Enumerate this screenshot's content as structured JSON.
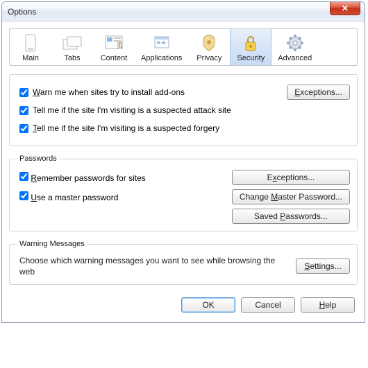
{
  "window": {
    "title": "Options",
    "close_glyph": "✕"
  },
  "toolbar": {
    "items": [
      {
        "label": "Main"
      },
      {
        "label": "Tabs"
      },
      {
        "label": "Content"
      },
      {
        "label": "Applications"
      },
      {
        "label": "Privacy"
      },
      {
        "label": "Security"
      },
      {
        "label": "Advanced"
      }
    ],
    "selected_index": 5
  },
  "group_top": {
    "warn_addons_prefix": "W",
    "warn_addons_rest": "arn me when sites try to install add-ons",
    "warn_addons_checked": true,
    "attack_site": "Tell me if the site I'm visiting is a suspected attack site",
    "attack_site_checked": true,
    "forgery_prefix": "T",
    "forgery_rest": "ell me if the site I'm visiting is a suspected forgery",
    "forgery_checked": true,
    "exceptions_u": "E",
    "exceptions_rest": "xceptions..."
  },
  "passwords": {
    "legend": "Passwords",
    "remember_prefix": "R",
    "remember_rest": "emember passwords for sites",
    "remember_checked": true,
    "master_prefix": "U",
    "master_rest": "se a master password",
    "master_checked": true,
    "exceptions_u": "x",
    "exceptions_pre": "E",
    "exceptions_post": "ceptions...",
    "change_pre": "Change ",
    "change_u": "M",
    "change_post": "aster Password...",
    "saved_pre": "Saved ",
    "saved_u": "P",
    "saved_post": "asswords..."
  },
  "warnings": {
    "legend": "Warning Messages",
    "text": "Choose which warning messages you want to see while browsing the web",
    "settings_u": "S",
    "settings_rest": "ettings..."
  },
  "footer": {
    "ok": "OK",
    "cancel": "Cancel",
    "help_u": "H",
    "help_rest": "elp"
  }
}
